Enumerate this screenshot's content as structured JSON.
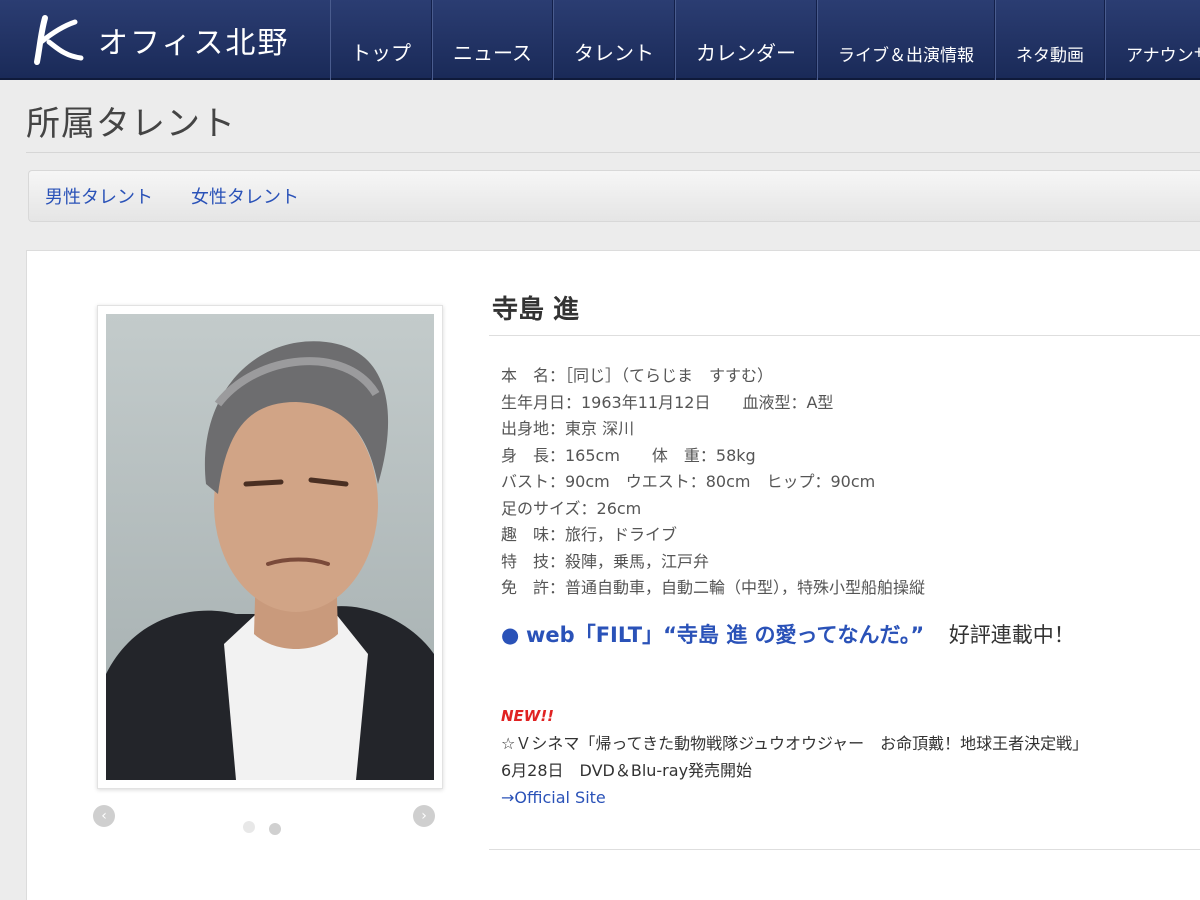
{
  "header": {
    "brand_name": "オフィス北野",
    "nav": [
      "トップ",
      "ニュース",
      "タレント",
      "カレンダー",
      "ライブ＆出演情報",
      "ネタ動画",
      "アナウンサー"
    ]
  },
  "page": {
    "title": "所属タレント"
  },
  "subnav": {
    "items": [
      "男性タレント",
      "女性タレント"
    ]
  },
  "talent": {
    "name": "寺島 進",
    "profile": [
      "本　名：［同じ］（てらじま　すすむ）",
      "生年月日：1963年11月12日　　血液型：A型",
      "出身地：東京 深川",
      "身　長：165cm　　体　重：58kg",
      "バスト：90cm　ウエスト：80cm　ヒップ：90cm",
      "足のサイズ：26cm",
      "趣　味：旅行，ドライブ",
      "特　技：殺陣，乗馬，江戸弁",
      "免　許：普通自動車，自動二輪（中型），特殊小型船舶操縦"
    ],
    "feature": {
      "bullet": "●",
      "link_text": "web「FILT」“寺島 進 の愛ってなんだ。”",
      "tail": "好評連載中！"
    },
    "news": {
      "badge": "NEW!!",
      "line1": "☆Ｖシネマ「帰ってきた動物戦隊ジュウオウジャー　お命頂戴！地球王者決定戦」",
      "line2": "6月28日　DVD＆Blu-ray発売開始",
      "link": "→Official Site"
    }
  },
  "carousel": {
    "prev_icon": "chevron-left-icon",
    "next_icon": "chevron-right-icon",
    "active_index": 1,
    "count": 2
  }
}
